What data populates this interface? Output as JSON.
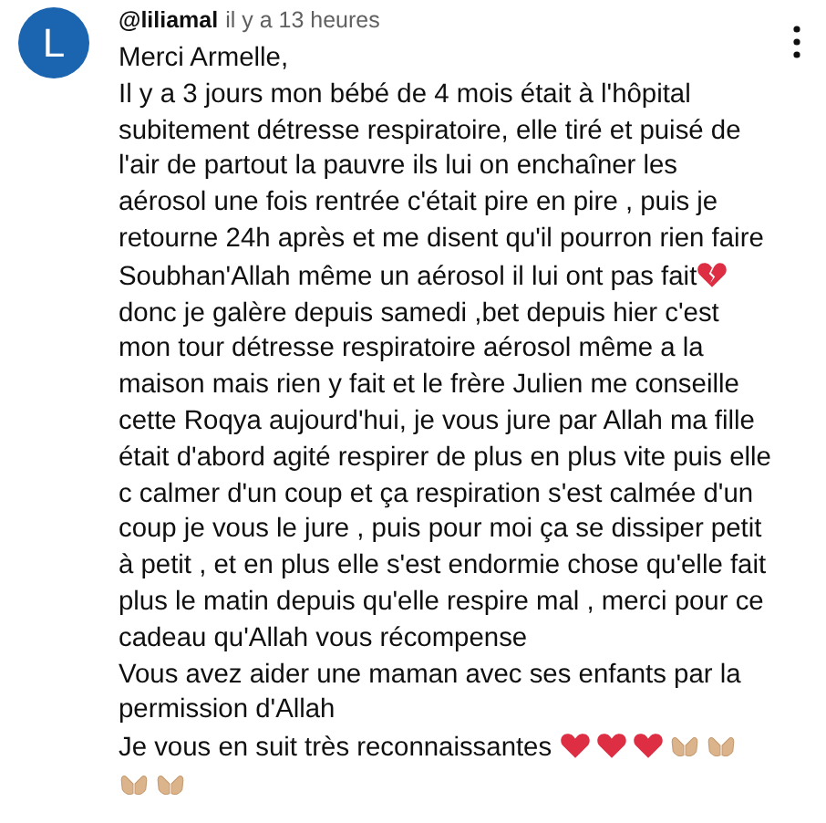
{
  "comment": {
    "avatar_letter": "L",
    "author": "@liliamal",
    "time": "il y a 13 heures",
    "paragraphs": [
      [
        {
          "kind": "text",
          "text": "Merci Armelle,"
        }
      ],
      [
        {
          "kind": "text",
          "text": "Il y a 3 jours mon bébé de 4 mois était à l'hôpital subitement détresse respiratoire, elle tiré et puisé de l'air de partout la pauvre ils lui on enchaîner les aérosol une fois rentrée c'était pire en pire , puis je retourne 24h après et me disent qu'il pourron rien faire Soubhan'Allah même un aérosol il lui ont pas fait"
        },
        {
          "kind": "broken_heart"
        },
        {
          "kind": "text",
          "text": " donc je galère depuis samedi ,bet depuis hier c'est mon tour détresse respiratoire aérosol même a la maison mais rien y fait et le frère Julien me conseille cette Roqya aujourd'hui, je vous jure par Allah ma fille était d'abord agité respirer de plus en plus vite puis elle c calmer d'un coup et ça respiration s'est calmée d'un coup je vous le jure , puis pour moi ça se dissiper petit à petit , et en plus elle s'est endormie chose qu'elle fait plus le matin depuis qu'elle respire mal , merci pour ce cadeau qu'Allah vous récompense"
        }
      ],
      [
        {
          "kind": "text",
          "text": "Vous avez aider une maman avec ses enfants par la permission d'Allah"
        }
      ],
      [
        {
          "kind": "text",
          "text": "Je vous en suit très reconnaissantes "
        },
        {
          "kind": "heart"
        },
        {
          "kind": "heart"
        },
        {
          "kind": "heart"
        },
        {
          "kind": "praying_hands"
        },
        {
          "kind": "praying_hands"
        },
        {
          "kind": "praying_hands"
        },
        {
          "kind": "praying_hands"
        }
      ]
    ]
  }
}
